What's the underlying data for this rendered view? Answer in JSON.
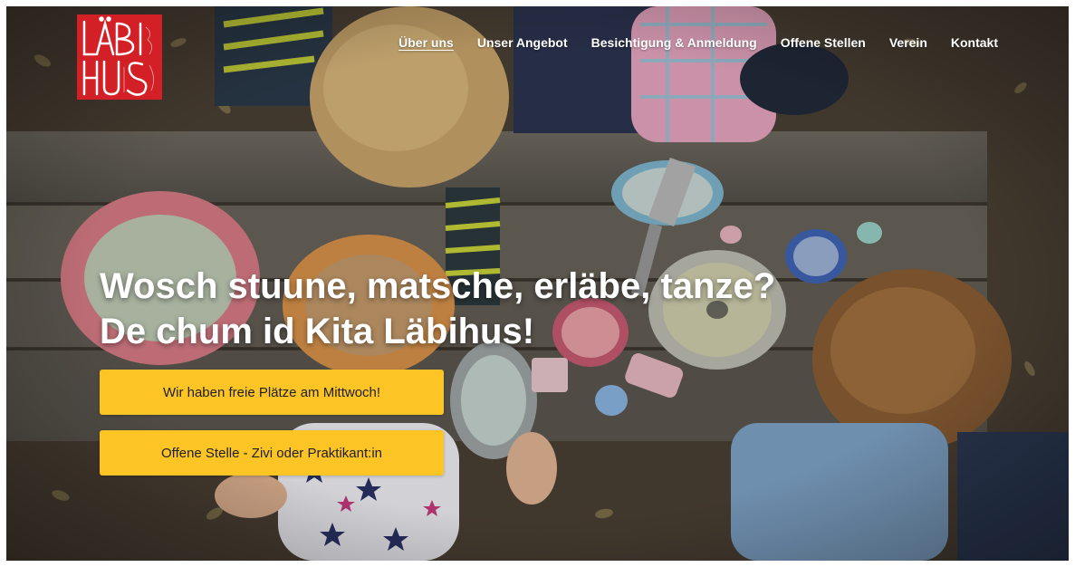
{
  "logo": {
    "text": "LÄBI HUS",
    "color": "#d31f26"
  },
  "nav": {
    "items": [
      {
        "label": "Über uns",
        "active": true
      },
      {
        "label": "Unser Angebot",
        "active": false
      },
      {
        "label": "Besichtigung & Anmeldung",
        "active": false
      },
      {
        "label": "Offene Stellen",
        "active": false
      },
      {
        "label": "Verein",
        "active": false
      },
      {
        "label": "Kontakt",
        "active": false
      }
    ]
  },
  "hero": {
    "headline_line1": "Wosch stuune, matsche, erläbe, tanze?",
    "headline_line2": "De chum id Kita Läbihus!",
    "buttons": [
      {
        "label": "Wir haben freie Plätze am Mittwoch!"
      },
      {
        "label": "Offene Stelle - Zivi oder Praktikant:in"
      }
    ]
  },
  "colors": {
    "accent": "#fcc525",
    "text_light": "#ffffff"
  }
}
